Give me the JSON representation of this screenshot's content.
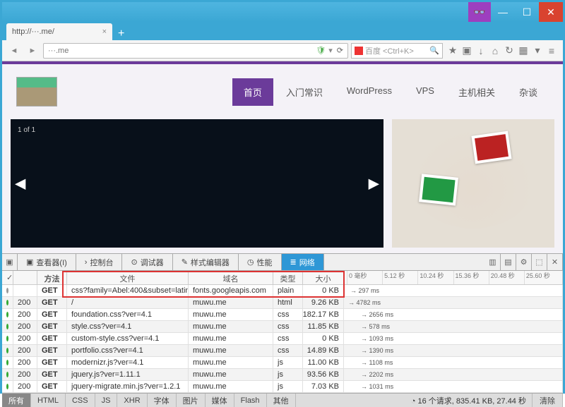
{
  "window": {
    "min": "—",
    "max": "☐",
    "close": "✕",
    "incognito": "👓"
  },
  "browser": {
    "tab_title": "http://···.me/",
    "tab_close": "×",
    "newtab": "+",
    "url": "···.me",
    "url_shield": "🛡",
    "url_drop": "▾",
    "reload": "⟳",
    "search_placeholder": "百度 <Ctrl+K>",
    "search_go": "🔍",
    "icons": [
      "★",
      "▣",
      "↓",
      "⌂",
      "↻",
      "▦",
      "▾",
      "≡"
    ]
  },
  "site": {
    "nav": [
      {
        "label": "首页",
        "active": true
      },
      {
        "label": "入门常识",
        "active": false
      },
      {
        "label": "WordPress",
        "active": false
      },
      {
        "label": "VPS",
        "active": false
      },
      {
        "label": "主机相关",
        "active": false
      },
      {
        "label": "杂谈",
        "active": false
      }
    ],
    "hero_counter": "1 of 1",
    "hero_left": "◀",
    "hero_right": "▶"
  },
  "dev": {
    "tabs": [
      {
        "icon": "▣",
        "label": "查看器(I)"
      },
      {
        "icon": "›",
        "label": "控制台"
      },
      {
        "icon": "⊙",
        "label": "调试器"
      },
      {
        "icon": "✎",
        "label": "样式编辑器"
      },
      {
        "icon": "◷",
        "label": "性能"
      },
      {
        "icon": "≣",
        "label": "网络",
        "active": true
      }
    ],
    "side_icons": [
      "▥",
      "▤",
      "⚙",
      "⬚",
      "✕"
    ],
    "headers": {
      "status": "",
      "method": "方法",
      "file": "文件",
      "domain": "域名",
      "type": "类型",
      "size": "大小"
    },
    "time_ticks": [
      "0 毫秒",
      "5.12 秒",
      "10.24 秒",
      "15.36 秒",
      "20.48 秒",
      "25.60 秒"
    ],
    "rows": [
      {
        "dot": "grey",
        "status": "",
        "method": "GET",
        "file": "css?family=Abel:400&subset=latin…",
        "domain": "fonts.googleapis.com",
        "type": "plain",
        "size": "0 KB",
        "tl": {
          "w": 2,
          "c": "#3a3",
          "lbl": "297 ms",
          "off": 1
        }
      },
      {
        "dot": "green",
        "status": "200",
        "method": "GET",
        "file": "/",
        "domain": "muwu.me",
        "type": "html",
        "size": "9.26 KB",
        "tl": {
          "w": 28,
          "c": "#2a7ac7",
          "lbl": "4782 ms",
          "off": 0
        }
      },
      {
        "dot": "green",
        "status": "200",
        "method": "GET",
        "file": "foundation.css?ver=4.1",
        "domain": "muwu.me",
        "type": "css",
        "size": "182.17 KB",
        "tl": {
          "w": 20,
          "c": "#3a3",
          "lbl": "2656 ms",
          "off": 6
        }
      },
      {
        "dot": "green",
        "status": "200",
        "method": "GET",
        "file": "style.css?ver=4.1",
        "domain": "muwu.me",
        "type": "css",
        "size": "11.85 KB",
        "tl": {
          "w": 6,
          "c": "#3a3",
          "lbl": "578 ms",
          "off": 6
        }
      },
      {
        "dot": "green",
        "status": "200",
        "method": "GET",
        "file": "custom-style.css?ver=4.1",
        "domain": "muwu.me",
        "type": "css",
        "size": "0 KB",
        "tl": {
          "w": 9,
          "c": "#3a3",
          "lbl": "1093 ms",
          "off": 6
        }
      },
      {
        "dot": "green",
        "status": "200",
        "method": "GET",
        "file": "portfolio.css?ver=4.1",
        "domain": "muwu.me",
        "type": "css",
        "size": "14.89 KB",
        "tl": {
          "w": 11,
          "c": "#3a3",
          "lbl": "1390 ms",
          "off": 6
        }
      },
      {
        "dot": "green",
        "status": "200",
        "method": "GET",
        "file": "modernizr.js?ver=4.1",
        "domain": "muwu.me",
        "type": "js",
        "size": "11.00 KB",
        "tl": {
          "w": 9,
          "c": "#e38a1a",
          "lbl": "1108 ms",
          "off": 6
        }
      },
      {
        "dot": "green",
        "status": "200",
        "method": "GET",
        "file": "jquery.js?ver=1.11.1",
        "domain": "muwu.me",
        "type": "js",
        "size": "93.56 KB",
        "tl": {
          "w": 16,
          "c": "#e38a1a",
          "lbl": "2202 ms",
          "off": 6
        }
      },
      {
        "dot": "green",
        "status": "200",
        "method": "GET",
        "file": "jquery-migrate.min.js?ver=1.2.1",
        "domain": "muwu.me",
        "type": "js",
        "size": "7.03 KB",
        "tl": {
          "w": 9,
          "c": "#e38a1a",
          "lbl": "1031 ms",
          "off": 6
        }
      }
    ],
    "filters": [
      "所有",
      "HTML",
      "CSS",
      "JS",
      "XHR",
      "字体",
      "图片",
      "媒体",
      "Flash",
      "其他"
    ],
    "status_icon": "◔",
    "status_text": "16 个请求, 835.41 KB, 27.44 秒",
    "clear": "清除"
  }
}
